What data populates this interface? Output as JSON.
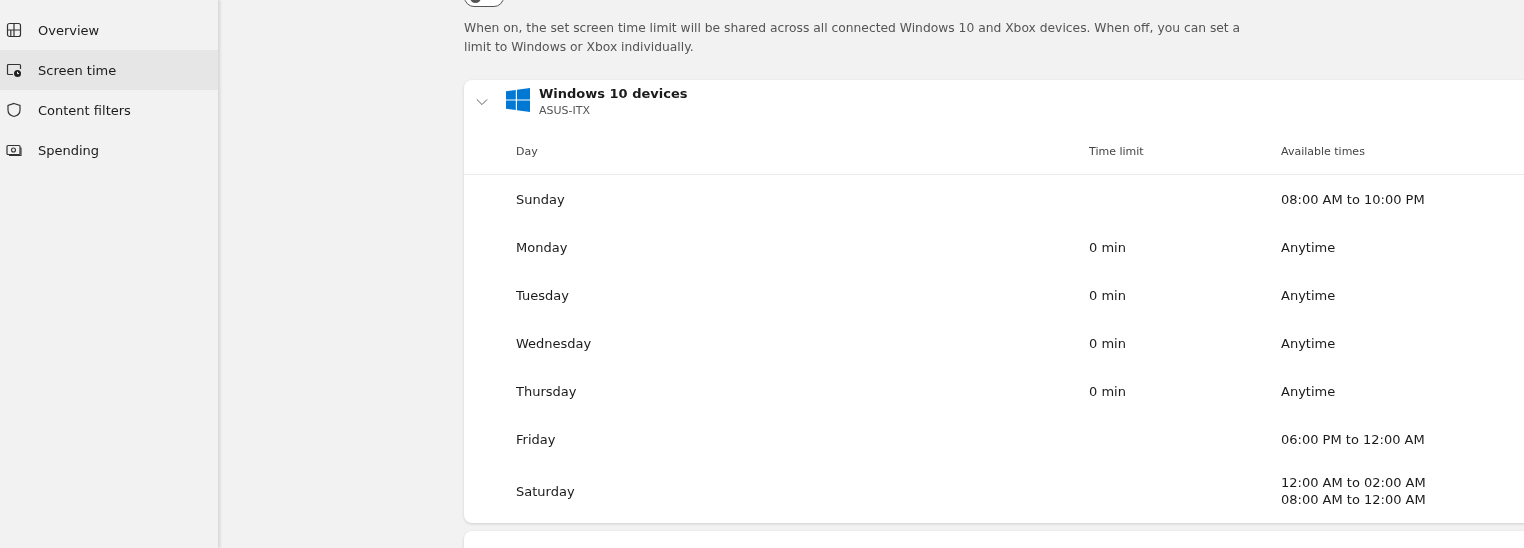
{
  "sidebar": {
    "items": [
      {
        "label": "Overview",
        "selected": false
      },
      {
        "label": "Screen time",
        "selected": true
      },
      {
        "label": "Content filters",
        "selected": false
      },
      {
        "label": "Spending",
        "selected": false
      }
    ]
  },
  "sync_toggle": {
    "on": false
  },
  "description": "When on, the set screen time limit will be shared across all connected Windows 10 and Xbox devices. When off, you can set a limit to Windows or Xbox individually.",
  "device_card": {
    "title": "Windows 10 devices",
    "subtitle": "ASUS-ITX",
    "expanded": true,
    "columns": [
      "Day",
      "Time limit",
      "Available times"
    ],
    "rows": [
      {
        "day": "Sunday",
        "limit": "",
        "times": [
          "08:00 AM to 10:00 PM"
        ]
      },
      {
        "day": "Monday",
        "limit": "0 min",
        "times": [
          "Anytime"
        ]
      },
      {
        "day": "Tuesday",
        "limit": "0 min",
        "times": [
          "Anytime"
        ]
      },
      {
        "day": "Wednesday",
        "limit": "0 min",
        "times": [
          "Anytime"
        ]
      },
      {
        "day": "Thursday",
        "limit": "0 min",
        "times": [
          "Anytime"
        ]
      },
      {
        "day": "Friday",
        "limit": "",
        "times": [
          "06:00 PM to 12:00 AM"
        ]
      },
      {
        "day": "Saturday",
        "limit": "",
        "times": [
          "12:00 AM to 02:00 AM",
          "08:00 AM to 12:00 AM"
        ]
      }
    ]
  }
}
